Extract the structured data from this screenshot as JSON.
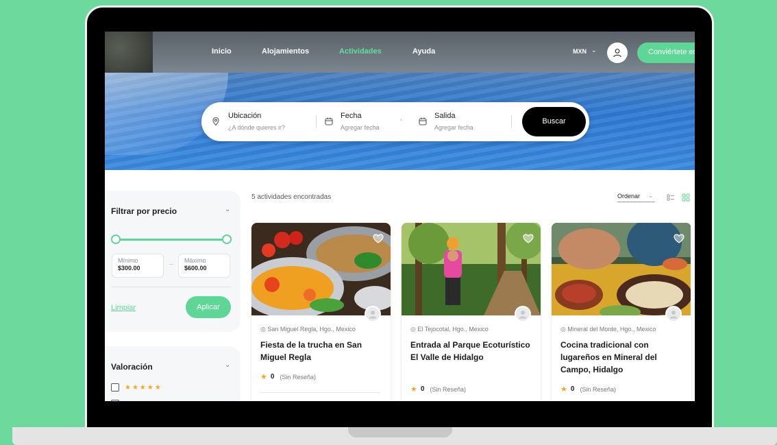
{
  "nav": {
    "links": [
      "Inicio",
      "Alojamientos",
      "Actividades",
      "Ayuda"
    ],
    "currency": "MXN",
    "cta": "Conviértete en anfitrión"
  },
  "search": {
    "location_title": "Ubicación",
    "location_sub": "¿A dónde quieres ir?",
    "date_title": "Fecha",
    "date_sub": "Agregar fecha",
    "out_title": "Salida",
    "out_sub": "Agregar fecha",
    "button": "Buscar"
  },
  "filters": {
    "price_title": "Filtrar por precio",
    "min_label": "Mínimo",
    "min_value": "$300.00",
    "max_label": "Máximo",
    "max_value": "$600.00",
    "clear": "Limpiar",
    "apply": "Aplicar",
    "rating_title": "Valoración",
    "rating_stars": "★★★★★"
  },
  "results": {
    "count": "5 actividades encontradas",
    "sort": "Ordenar"
  },
  "cards": [
    {
      "location": "San Miguel Regla, Hgo., Mexico",
      "title": "Fiesta de la trucha en San Miguel Regla",
      "rating": "0",
      "reviews": "(Sin Reseña)"
    },
    {
      "location": "El Tejocotal, Hgo., Mexico",
      "title": "Entrada al Parque Ecoturístico El Valle de Hidalgo",
      "rating": "0",
      "reviews": "(Sin Reseña)"
    },
    {
      "location": "Mineral del Monte, Hgo., Mexico",
      "title": "Cocina tradicional con lugareños en Mineral del Campo, Hidalgo",
      "rating": "0",
      "reviews": "(Sin Reseña)"
    }
  ],
  "colors": {
    "accent": "#5ed796",
    "background": "#6ed99c",
    "star": "#f5a623"
  }
}
